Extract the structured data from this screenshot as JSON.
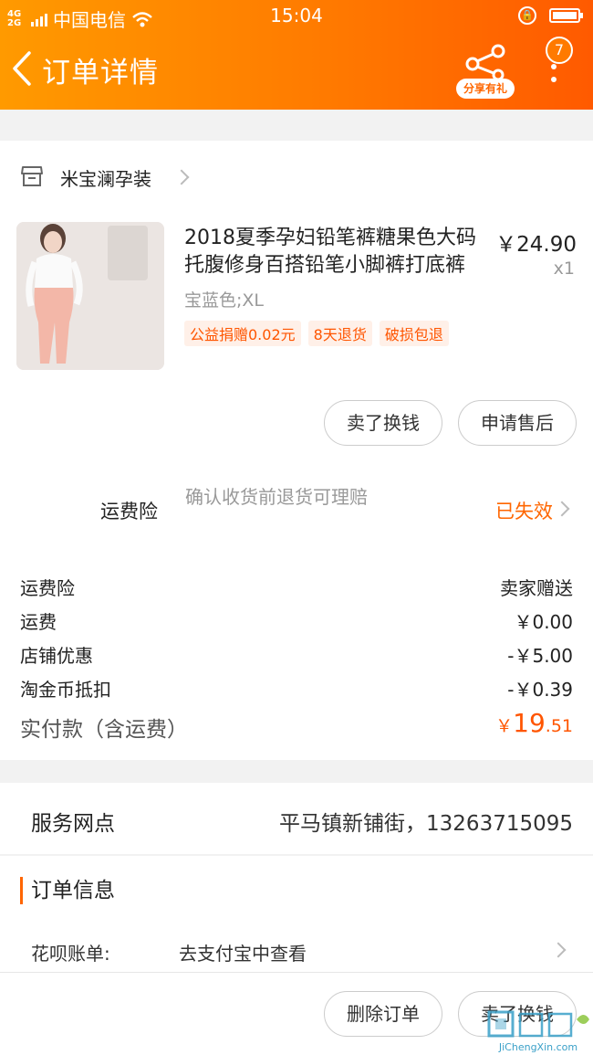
{
  "status_bar": {
    "network": "4G 2G",
    "carrier": "中国电信",
    "time": "15:04"
  },
  "nav": {
    "title": "订单详情",
    "share_label": "分享有礼",
    "badge_count": "7"
  },
  "shop": {
    "name": "米宝澜孕装"
  },
  "product": {
    "title": "2018夏季孕妇铅笔裤糖果色大码托腹修身百搭铅笔小脚裤打底裤",
    "price": "￥24.90",
    "quantity": "x1",
    "sku": "宝蓝色;XL",
    "tags": [
      "公益捐赠0.02元",
      "8天退货",
      "破损包退"
    ]
  },
  "item_actions": {
    "sell": "卖了换钱",
    "after_sale": "申请售后"
  },
  "insurance": {
    "label": "运费险",
    "desc": "确认收货前退货可理赔",
    "status": "已失效"
  },
  "fees": [
    {
      "label": "运费险",
      "value": "卖家赠送"
    },
    {
      "label": "运费",
      "value": "￥0.00"
    },
    {
      "label": "店铺优惠",
      "value": "-￥5.00"
    },
    {
      "label": "淘金币抵扣",
      "value": "-￥0.39"
    }
  ],
  "total": {
    "label": "实付款（含运费）",
    "currency": "￥",
    "integer": "19",
    "decimal": ".51"
  },
  "service": {
    "label": "服务网点",
    "value": "平马镇新铺街，13263715095"
  },
  "order_info": {
    "title": "订单信息",
    "huabei_label": "花呗账单:",
    "huabei_value": "去支付宝中查看"
  },
  "bottom_actions": {
    "delete": "删除订单",
    "sell": "卖了换钱"
  },
  "watermark": {
    "text": "JiChengXin.com"
  },
  "colors": {
    "header_start": "#ff9a00",
    "header_end": "#ff5a00",
    "accent": "#ff6600",
    "tag_bg": "#fff0e8"
  }
}
